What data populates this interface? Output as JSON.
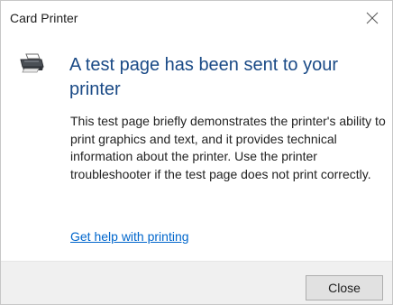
{
  "window": {
    "title": "Card Printer",
    "close_icon": "close-icon"
  },
  "content": {
    "icon": "printer-icon",
    "heading": "A test page has been sent to your printer",
    "body": "This test page briefly demonstrates the printer's ability to print graphics and text, and it provides technical information about the printer. Use the printer troubleshooter if the test page does not print correctly.",
    "help_link": "Get help with printing"
  },
  "footer": {
    "close_label": "Close"
  },
  "colors": {
    "heading": "#1a4a86",
    "link": "#0066cc",
    "footer_bg": "#f0f0f0"
  }
}
